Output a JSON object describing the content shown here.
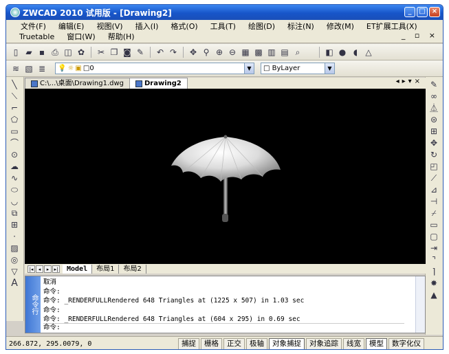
{
  "window": {
    "title": "ZWCAD 2010 试用版 - [Drawing2]"
  },
  "menu": {
    "row1": [
      "文件(F)",
      "编辑(E)",
      "视图(V)",
      "插入(I)",
      "格式(O)",
      "工具(T)",
      "绘图(D)",
      "标注(N)",
      "修改(M)",
      "ET扩展工具(X)"
    ],
    "row2": [
      "Truetable",
      "窗口(W)",
      "帮助(H)"
    ]
  },
  "layer": {
    "name": "0",
    "linetype": "ByLayer"
  },
  "doc_tabs": [
    "C:\\...\\桌面\\Drawing1.dwg",
    "Drawing2"
  ],
  "layout_tabs": [
    "Model",
    "布局1",
    "布局2"
  ],
  "command": {
    "side_label": "命令行",
    "lines": [
      "取消",
      "命令:",
      "命令: _RENDERFULLRendered 648 Triangles at (1225 x 507) in 1.03 sec",
      "命令:",
      "命令: _RENDERFULLRendered 648 Triangles at (604 x 295) in 0.69 sec"
    ],
    "prompt": "命令:"
  },
  "status": {
    "coords": "266.872, 295.0079, 0",
    "buttons": [
      "捕捉",
      "栅格",
      "正交",
      "极轴",
      "对象捕捉",
      "对象追踪",
      "线宽",
      "模型",
      "数字化仪"
    ]
  },
  "icons": {
    "left_tools": [
      "line-icon",
      "ray-icon",
      "polyline-icon",
      "polygon-icon",
      "rectangle-icon",
      "arc-icon",
      "circle-icon",
      "revcloud-icon",
      "spline-icon",
      "ellipse-icon",
      "ellipse-arc-icon",
      "insert-block-icon",
      "make-block-icon",
      "point-icon",
      "hatch-icon",
      "region-icon",
      "table-icon",
      "text-icon"
    ],
    "right_tools": [
      "erase-icon",
      "copy-icon",
      "mirror-icon",
      "offset-icon",
      "array-icon",
      "move-icon",
      "rotate-icon",
      "scale-icon",
      "stretch-icon",
      "trim-icon",
      "extend-icon",
      "break-icon",
      "chamfer-icon",
      "fillet-icon",
      "explode-icon"
    ]
  }
}
